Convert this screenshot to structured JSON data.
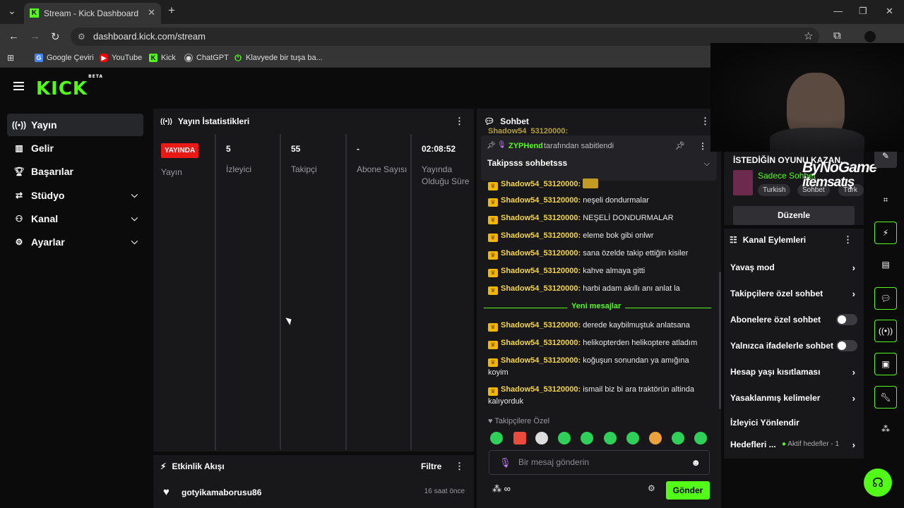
{
  "browser": {
    "tab_title": "Stream - Kick Dashboard",
    "url": "dashboard.kick.com/stream",
    "bookmarks": [
      {
        "label": "Google Çeviri",
        "icon": "translate-icon"
      },
      {
        "label": "YouTube",
        "icon": "youtube-icon"
      },
      {
        "label": "Kick",
        "icon": "kick-icon"
      },
      {
        "label": "ChatGPT",
        "icon": "chatgpt-icon"
      },
      {
        "label": "Klavyede bir tuşa ba...",
        "icon": "power-icon"
      }
    ]
  },
  "brand": {
    "logo": "KICK",
    "beta": "BETA",
    "accent": "#53fc18"
  },
  "sidebar": {
    "items": [
      {
        "label": "Yayın",
        "icon": "broadcast-icon"
      },
      {
        "label": "Gelir",
        "icon": "chart-icon"
      },
      {
        "label": "Başarılar",
        "icon": "trophy-icon"
      },
      {
        "label": "Stüdyo",
        "icon": "studio-icon"
      },
      {
        "label": "Kanal",
        "icon": "users-icon"
      },
      {
        "label": "Ayarlar",
        "icon": "gear-icon"
      }
    ]
  },
  "stats": {
    "title": "Yayın İstatistikleri",
    "live_badge": "YAYINDA",
    "columns": [
      {
        "value": "",
        "label": "Yayın"
      },
      {
        "value": "5",
        "label": "İzleyici"
      },
      {
        "value": "55",
        "label": "Takipçi"
      },
      {
        "value": "-",
        "label": "Abone Sayısı"
      },
      {
        "value": "02:08:52",
        "label": "Yayında Olduğu Süre"
      }
    ]
  },
  "activity": {
    "title": "Etkinlik Akışı",
    "filter": "Filtre",
    "items": [
      {
        "user": "gotyikamaborusu86",
        "time": "16 saat önce"
      }
    ]
  },
  "chat": {
    "title": "Sohbet",
    "pinned_user": "ZYPHend",
    "pinned_suffix": "tarafından sabitlendi",
    "pinned_text": "Takipsss sohbetsss",
    "top_partial": "Shadow54_53120000:",
    "messages": [
      {
        "user": "Shadow54_53120000:",
        "text": ""
      },
      {
        "user": "Shadow54_53120000:",
        "text": "neşeli dondurmalar"
      },
      {
        "user": "Shadow54_53120000:",
        "text": "NEŞELİ DONDURMALAR"
      },
      {
        "user": "Shadow54_53120000:",
        "text": "eleme bok gibi onlwr"
      },
      {
        "user": "Shadow54_53120000:",
        "text": "sana özelde takip ettiğin kisiler"
      },
      {
        "user": "Shadow54_53120000:",
        "text": "kahve almaya gitti"
      },
      {
        "user": "Shadow54_53120000:",
        "text": "harbi adam akıllı anı anlat la"
      }
    ],
    "new_label": "Yeni mesajlar",
    "new_messages": [
      {
        "user": "Shadow54_53120000:",
        "text": "derede kaybilmuştuk anlatsana"
      },
      {
        "user": "Shadow54_53120000:",
        "text": "helikopterden helikoptere atladım"
      },
      {
        "user": "Shadow54_53120000:",
        "text": "koğuşun sonundan ya amığına koyim"
      },
      {
        "user": "Shadow54_53120000:",
        "text": "ismail biz bi ara traktörün altinda kalıyorduk"
      }
    ],
    "followers_only": "Takipçilere Özel",
    "input_placeholder": "Bir mesaj gönderin",
    "send_label": "Gönder"
  },
  "stream_info": {
    "title": "İSTEDİĞİN OYUNU KAZAN.",
    "category": "Sadece Sohbet",
    "tags": [
      "Turkish",
      "Sohbet",
      "Türk"
    ],
    "edit_label": "Düzenle"
  },
  "overlay_brand": {
    "line1": "ByNoGame",
    "line2": "itemsatış"
  },
  "channel_actions": {
    "title": "Kanal Eylemleri",
    "items": [
      {
        "label": "Yavaş mod",
        "type": "chevron"
      },
      {
        "label": "Takipçilere özel sohbet",
        "type": "chevron"
      },
      {
        "label": "Abonelere özel sohbet",
        "type": "toggle"
      },
      {
        "label": "Yalnızca ifadelerle sohbet",
        "type": "toggle"
      },
      {
        "label": "Hesap yaşı kısıtlaması",
        "type": "chevron"
      },
      {
        "label": "Yasaklanmış kelimeler",
        "type": "chevron"
      },
      {
        "label": "İzleyici Yönlendir",
        "type": "none"
      },
      {
        "label": "Hedefleri ...",
        "type": "chevron"
      }
    ],
    "goals_status": "Aktif hedefler - 1"
  }
}
